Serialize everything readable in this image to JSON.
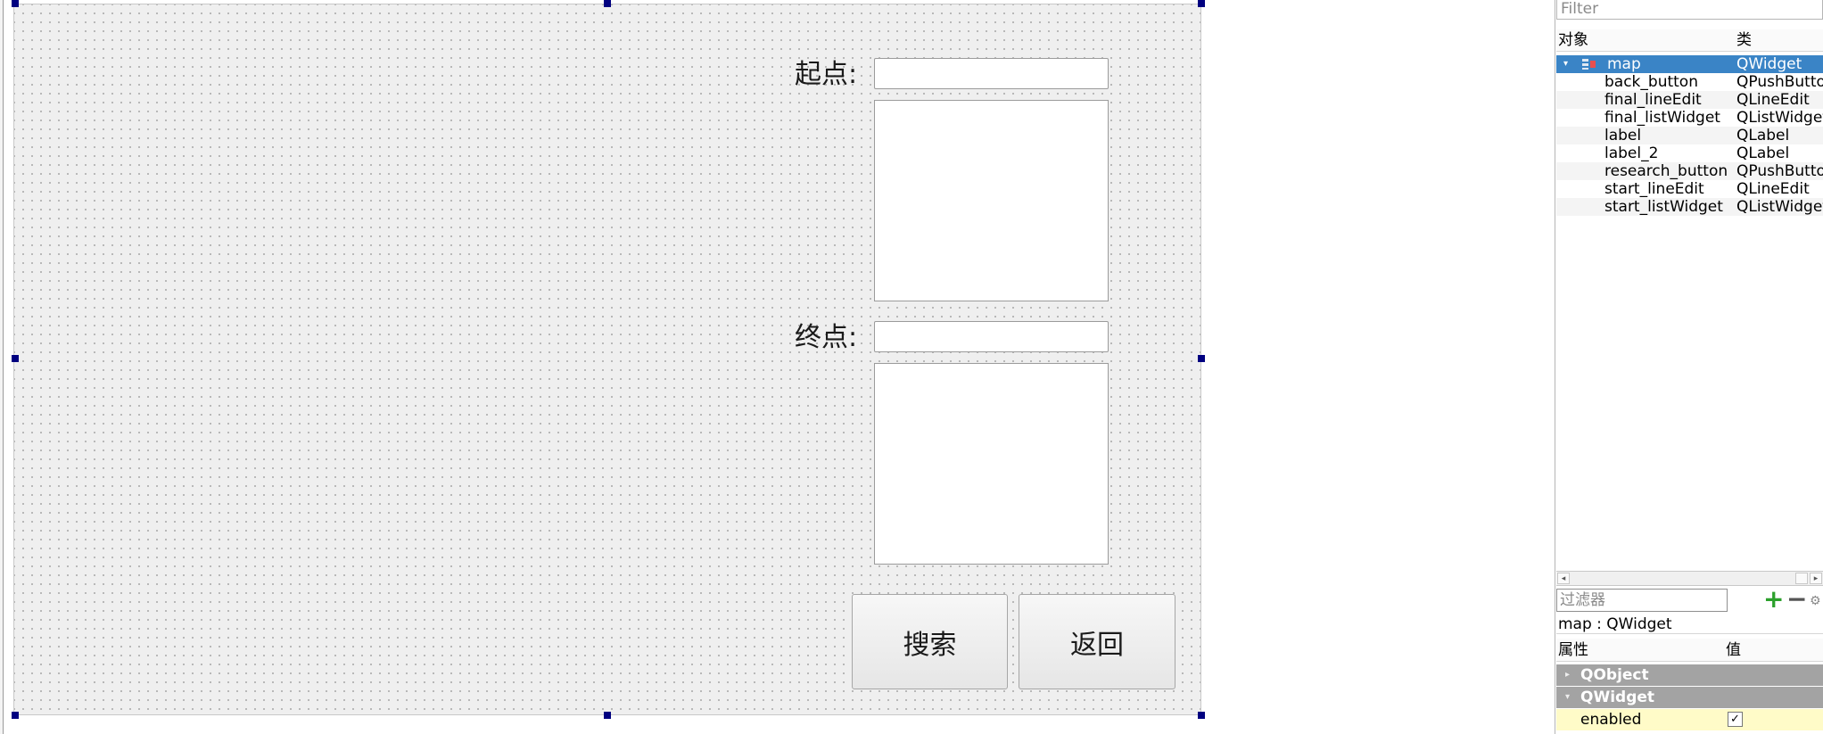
{
  "form": {
    "start_label": "起点:",
    "final_label": "终点:",
    "search_button": "搜索",
    "back_button": "返回"
  },
  "object_inspector": {
    "filter_placeholder": "Filter",
    "col_object": "对象",
    "col_class": "类",
    "rows": [
      {
        "name": "map",
        "class": "QWidget"
      },
      {
        "name": "back_button",
        "class": "QPushButton"
      },
      {
        "name": "final_lineEdit",
        "class": "QLineEdit"
      },
      {
        "name": "final_listWidget",
        "class": "QListWidget"
      },
      {
        "name": "label",
        "class": "QLabel"
      },
      {
        "name": "label_2",
        "class": "QLabel"
      },
      {
        "name": "research_button",
        "class": "QPushButton"
      },
      {
        "name": "start_lineEdit",
        "class": "QLineEdit"
      },
      {
        "name": "start_listWidget",
        "class": "QListWidget"
      }
    ]
  },
  "property_editor": {
    "filter_placeholder": "过滤器",
    "object_line": "map : QWidget",
    "col_property": "属性",
    "col_value": "值",
    "groups": [
      "QObject",
      "QWidget"
    ],
    "enabled_key": "enabled",
    "enabled_value": "✓"
  }
}
